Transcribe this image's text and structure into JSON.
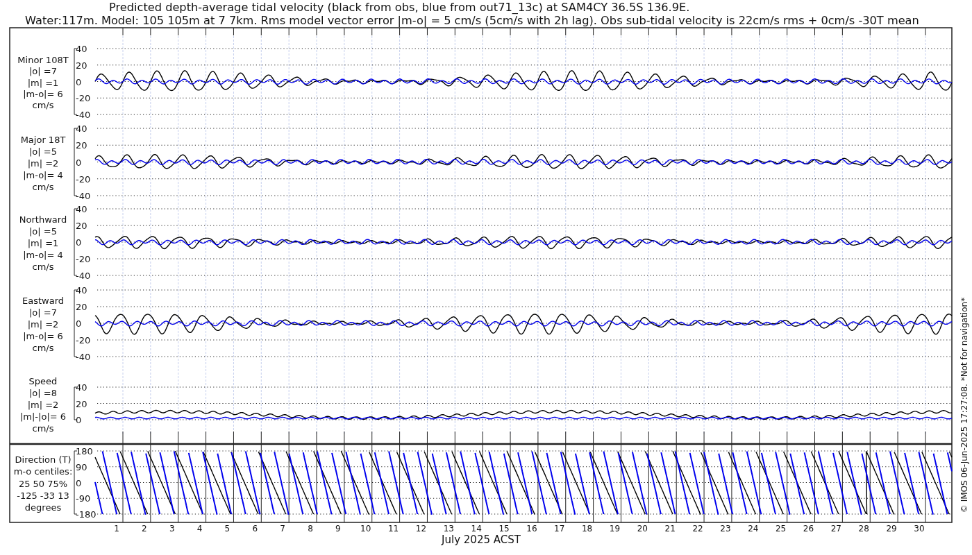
{
  "title_lines": [
    "Predicted depth-average tidal velocity (black from obs, blue from out71_13c) at SAM4CY 36.5S 136.9E.",
    "Water:117m. Model: 105 105m at 7 7km. Rms model vector error |m-o| = 5 cm/s (5cm/s with 2h lag). Obs sub-tidal velocity is 22cm/s rms + 0cm/s -30T mean"
  ],
  "panels": [
    {
      "kind": "velocity",
      "label_lines": [
        "Minor 108T",
        "|o| =7",
        "|m| =1",
        "|m-o|= 6",
        "cm/s"
      ],
      "yticks": [
        "40",
        "20",
        "0",
        "-20",
        "-40"
      ]
    },
    {
      "kind": "velocity",
      "label_lines": [
        "Major 18T",
        "|o| =5",
        "|m| =2",
        "|m-o|= 4",
        "cm/s"
      ],
      "yticks": [
        "40",
        "20",
        "0",
        "-20",
        "-40"
      ]
    },
    {
      "kind": "velocity",
      "label_lines": [
        "Northward",
        "|o| =5",
        "|m| =1",
        "|m-o|= 4",
        "cm/s"
      ],
      "yticks": [
        "40",
        "20",
        "0",
        "-20",
        "-40"
      ]
    },
    {
      "kind": "velocity",
      "label_lines": [
        "Eastward",
        "|o| =7",
        "|m| =2",
        "|m-o|= 6",
        "cm/s"
      ],
      "yticks": [
        "40",
        "20",
        "0",
        "-20",
        "-40"
      ]
    },
    {
      "kind": "speed",
      "label_lines": [
        "Speed",
        "|o| =8",
        "|m| =2",
        "|m|-|o|= 6",
        "cm/s"
      ],
      "yticks": [
        "40",
        "20",
        "0"
      ]
    },
    {
      "kind": "direction",
      "label_lines": [
        "Direction (T)",
        "m-o centiles:",
        "25  50  75%",
        "-125  -33   13",
        "degrees"
      ],
      "yticks": [
        "180",
        "90",
        "0",
        "-90",
        "-180"
      ]
    }
  ],
  "x_tick_labels": [
    "1",
    "2",
    "3",
    "4",
    "5",
    "6",
    "7",
    "8",
    "9",
    "10",
    "11",
    "12",
    "13",
    "14",
    "15",
    "16",
    "17",
    "18",
    "19",
    "20",
    "21",
    "22",
    "23",
    "24",
    "25",
    "26",
    "27",
    "28",
    "29",
    "30"
  ],
  "x_label": "July 2025 ACST",
  "side_note": "© IMOS 06-Jun-2025 17:27:08. *Not for navigation*"
}
